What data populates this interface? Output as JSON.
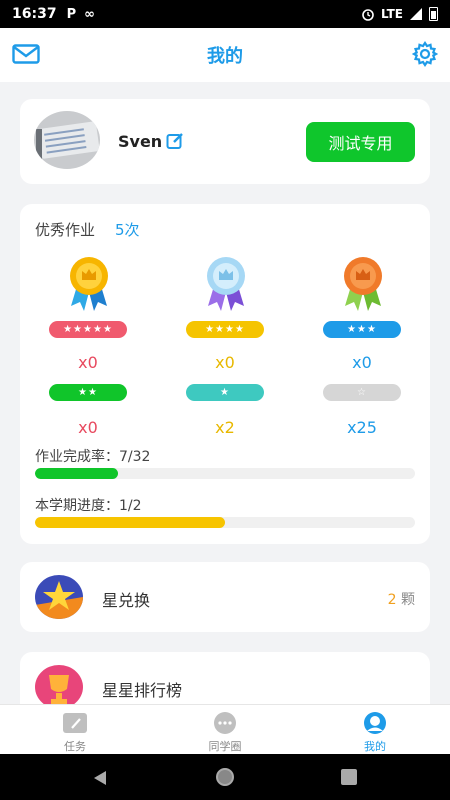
{
  "status": {
    "time": "16:37",
    "left_icons": [
      "P",
      "∞"
    ],
    "network": "LTE"
  },
  "navbar": {
    "title": "我的"
  },
  "profile": {
    "username": "Sven",
    "test_button": "测试专用"
  },
  "homework": {
    "label": "优秀作业",
    "count": "5次",
    "medals": [
      {
        "stars": "★★★★★",
        "count": "x0",
        "pill_color": "#f05a6e",
        "count_color": "#e84a5f"
      },
      {
        "stars": "★★★★",
        "count": "x0",
        "pill_color": "#f5c400",
        "count_color": "#e8b800"
      },
      {
        "stars": "★★★",
        "count": "x0",
        "pill_color": "#1e9be8",
        "count_color": "#1e9be8"
      }
    ],
    "badges": [
      {
        "stars": "★★",
        "count": "x0",
        "pill_color": "#10c52a",
        "count_color": "#e84a5f"
      },
      {
        "stars": "★",
        "count": "x2",
        "pill_color": "#3ec9c0",
        "count_color": "#e8b800"
      },
      {
        "stars": "☆",
        "count": "x25",
        "pill_color": "#d6d6d6",
        "count_color": "#1e9be8"
      }
    ],
    "completion": {
      "label": "作业完成率：7/32",
      "fraction": 0.21875,
      "color": "#10c52a"
    },
    "semester": {
      "label": "本学期进度：1/2",
      "fraction": 0.5,
      "color": "#f7c400"
    }
  },
  "exchange": {
    "title": "星兑换",
    "value": "2",
    "unit": "颗"
  },
  "ranking": {
    "title": "星星排行榜"
  },
  "tabbar": {
    "tabs": [
      {
        "label": "任务",
        "icon": "task-icon"
      },
      {
        "label": "同学圈",
        "icon": "chat-icon"
      },
      {
        "label": "我的",
        "icon": "profile-icon"
      }
    ]
  },
  "colors": {
    "accent": "#1e9be8",
    "green": "#0fc62c",
    "yellow": "#f7c400"
  }
}
